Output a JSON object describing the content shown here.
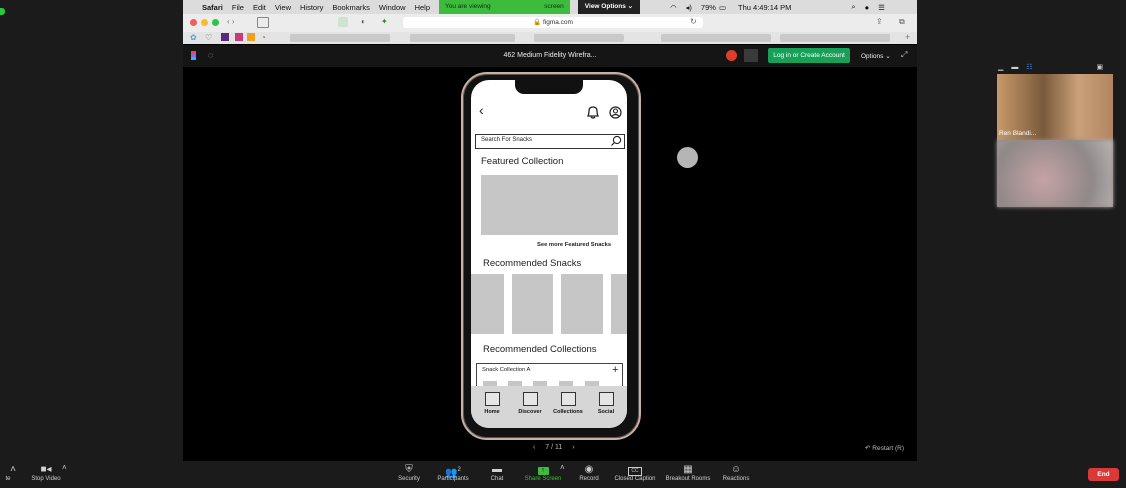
{
  "macos": {
    "apple": "",
    "app_name": "Safari",
    "menus": [
      "File",
      "Edit",
      "View",
      "History",
      "Bookmarks",
      "Window",
      "Help"
    ],
    "viewing_banner_left": "You are viewing",
    "viewing_banner_right": "screen",
    "view_options": "View Options ⌄",
    "battery": "79%",
    "clock": "Thu 4:49:14 PM"
  },
  "browser": {
    "url": "figma.com"
  },
  "figma": {
    "file_title": "462 Medium Fidelity Wirefra...",
    "login_button": "Log in or Create Account",
    "options": "Options ⌄",
    "slide_counter": "7 / 11",
    "restart": "Restart (R)"
  },
  "app_screen": {
    "search_placeholder": "Search For Snacks",
    "featured_title": "Featured Collection",
    "see_more": "See more Featured Snacks",
    "recommended_snacks": "Recommended Snacks",
    "recommended_collections": "Recommended Collections",
    "collection_item": "Snack Collection A",
    "nav": [
      "Home",
      "Discover",
      "Collections",
      "Social"
    ]
  },
  "participants": {
    "video1_name": "Ren Blandi..."
  },
  "zoom_toolbar": {
    "left_partial": "te",
    "stop_video": "Stop Video",
    "items": [
      {
        "label": "Security",
        "icon": "shield-icon"
      },
      {
        "label": "Participants",
        "icon": "participants-icon",
        "count": "2"
      },
      {
        "label": "Chat",
        "icon": "chat-icon"
      },
      {
        "label": "Share Screen",
        "icon": "share-screen-icon"
      },
      {
        "label": "Record",
        "icon": "record-icon"
      },
      {
        "label": "Closed Caption",
        "icon": "cc-icon"
      },
      {
        "label": "Breakout Rooms",
        "icon": "breakout-icon"
      },
      {
        "label": "Reactions",
        "icon": "reactions-icon"
      }
    ],
    "end": "End"
  },
  "colors": {
    "share_green": "#3dbb3d",
    "end_red": "#d93939",
    "figma_green": "#18a058"
  }
}
